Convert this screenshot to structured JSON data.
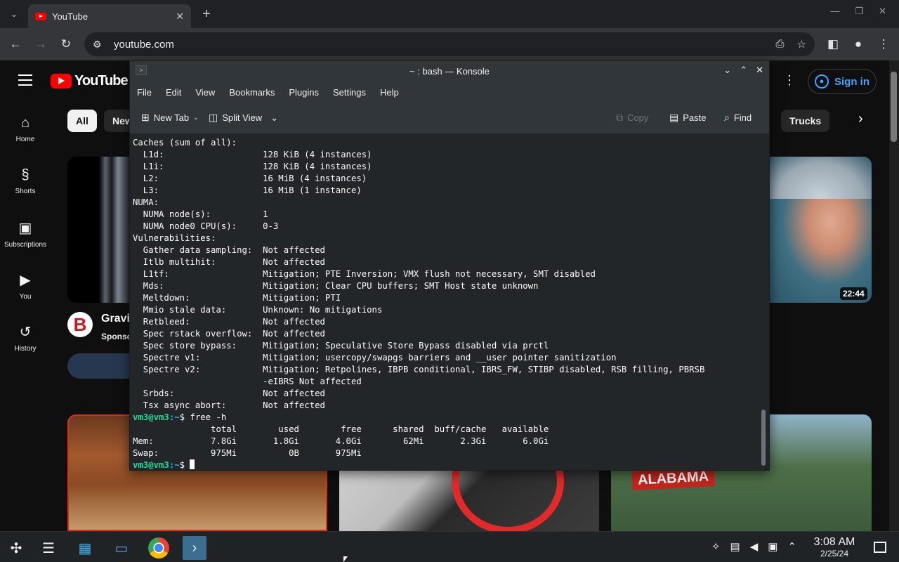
{
  "browser": {
    "tab_title": "YouTube",
    "url": "youtube.com",
    "new_tab_symbol": "+",
    "close_symbol": "✕"
  },
  "youtube": {
    "logo_text": "YouTube",
    "sign_in": "Sign in",
    "nav": [
      "Home",
      "Shorts",
      "Subscriptions",
      "You",
      "History"
    ],
    "chips": {
      "all": "All",
      "partial": "New",
      "trucks": "Trucks"
    },
    "duration": "22:44",
    "sponsor": {
      "avatar_letter": "B",
      "title": "Gravit",
      "label": "Sponso"
    },
    "banner_text": "ALABAMA",
    "colors": {
      "brand_red": "#ff0000",
      "link_blue": "#3ea6ff"
    }
  },
  "konsole": {
    "title": "~ : bash — Konsole",
    "menu": [
      "File",
      "Edit",
      "View",
      "Bookmarks",
      "Plugins",
      "Settings",
      "Help"
    ],
    "toolbar": {
      "new_tab": "New Tab",
      "split_view": "Split View",
      "copy": "Copy",
      "paste": "Paste",
      "find": "Find"
    },
    "output_lines": [
      "Caches (sum of all):",
      "  L1d:                   128 KiB (4 instances)",
      "  L1i:                   128 KiB (4 instances)",
      "  L2:                    16 MiB (4 instances)",
      "  L3:                    16 MiB (1 instance)",
      "NUMA:",
      "  NUMA node(s):          1",
      "  NUMA node0 CPU(s):     0-3",
      "Vulnerabilities:",
      "  Gather data sampling:  Not affected",
      "  Itlb multihit:         Not affected",
      "  L1tf:                  Mitigation; PTE Inversion; VMX flush not necessary, SMT disabled",
      "  Mds:                   Mitigation; Clear CPU buffers; SMT Host state unknown",
      "  Meltdown:              Mitigation; PTI",
      "  Mmio stale data:       Unknown: No mitigations",
      "  Retbleed:              Not affected",
      "  Spec rstack overflow:  Not affected",
      "  Spec store bypass:     Mitigation; Speculative Store Bypass disabled via prctl",
      "  Spectre v1:            Mitigation; usercopy/swapgs barriers and __user pointer sanitization",
      "  Spectre v2:            Mitigation; Retpolines, IBPB conditional, IBRS_FW, STIBP disabled, RSB filling, PBRSB",
      "                         -eIBRS Not affected",
      "  Srbds:                 Not affected",
      "  Tsx async abort:       Not affected"
    ],
    "prompt_user": "vm3@vm3",
    "prompt_dir": ":~",
    "prompt_symbol": "$",
    "command": " free -h",
    "free_output": [
      "               total        used        free      shared  buff/cache   available",
      "Mem:           7.8Gi       1.8Gi       4.0Gi        62Mi       2.3Gi       6.0Gi",
      "Swap:          975Mi          0B       975Mi"
    ]
  },
  "taskbar": {
    "time": "3:08 AM",
    "date": "2/25/24"
  }
}
